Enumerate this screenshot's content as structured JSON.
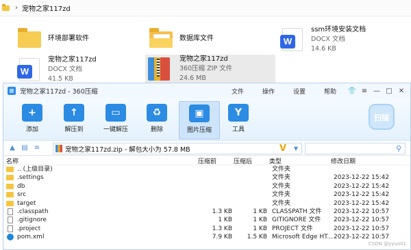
{
  "explorer": {
    "breadcrumb": "宠物之家117zd",
    "items": [
      {
        "name": "环境部署软件",
        "sub1": "",
        "sub2": "",
        "kind": "folder"
      },
      {
        "name": "数据库文件",
        "sub1": "",
        "sub2": "",
        "kind": "folder-open"
      },
      {
        "name": "ssm环境安装文档",
        "sub1": "DOCX 文档",
        "sub2": "14.6 KB",
        "kind": "docx"
      },
      {
        "name": "宠物之家117zd",
        "sub1": "DOCX 文档",
        "sub2": "41.5 KB",
        "kind": "docx"
      },
      {
        "name": "宠物之家117zd",
        "sub1": "360压缩 ZIP 文件",
        "sub2": "24.6 MB",
        "kind": "zip",
        "selected": true
      }
    ]
  },
  "zipwin": {
    "title": "宠物之家117zd - 360压缩",
    "menu": [
      "文件",
      "操作",
      "设置",
      "帮助"
    ],
    "toolbar": [
      {
        "label": "添加",
        "glyph": "+"
      },
      {
        "label": "解压到",
        "glyph": "↑"
      },
      {
        "label": "一键解压",
        "glyph": "▭"
      },
      {
        "label": "删除",
        "glyph": "♻"
      },
      {
        "label": "图片压缩",
        "glyph": "▣",
        "active": true
      },
      {
        "label": "工具",
        "glyph": "Y"
      }
    ],
    "scan_label": "扫描",
    "path_text": "宠物之家117zd.zip - 解包大小为 57.8 MB",
    "search_placeholder": "",
    "columns": {
      "name": "名称",
      "size": "压缩前",
      "packed": "压缩后",
      "type": "类型",
      "date": "修改日期"
    },
    "rows": [
      {
        "icon": "folder",
        "name": ".. (上级目录)",
        "size": "",
        "packed": "",
        "type": "文件夹",
        "date": ""
      },
      {
        "icon": "folder",
        "name": ".settings",
        "size": "",
        "packed": "",
        "type": "文件夹",
        "date": "2023-12-22 15:42"
      },
      {
        "icon": "folder",
        "name": "db",
        "size": "",
        "packed": "",
        "type": "文件夹",
        "date": "2023-12-22 15:42"
      },
      {
        "icon": "folder",
        "name": "src",
        "size": "",
        "packed": "",
        "type": "文件夹",
        "date": "2023-12-22 15:42"
      },
      {
        "icon": "folder",
        "name": "target",
        "size": "",
        "packed": "",
        "type": "文件夹",
        "date": "2023-12-22 15:42"
      },
      {
        "icon": "file",
        "name": ".classpath",
        "size": "1.3 KB",
        "packed": "1 KB",
        "type": "CLASSPATH 文件",
        "date": "2023-12-22 10:57"
      },
      {
        "icon": "file",
        "name": ".gitignore",
        "size": "1 KB",
        "packed": "1 KB",
        "type": "GITIGNORE 文件",
        "date": "2023-12-22 10:57"
      },
      {
        "icon": "file",
        "name": ".project",
        "size": "1.3 KB",
        "packed": "1 KB",
        "type": "PROJECT 文件",
        "date": "2023-12-22 10:57"
      },
      {
        "icon": "edge",
        "name": "pom.xml",
        "size": "7.9 KB",
        "packed": "1.5 KB",
        "type": "Microsoft Edge HT...",
        "date": "2023-12-22 10:57"
      }
    ],
    "watermark": "CSDN @yyuo01"
  }
}
